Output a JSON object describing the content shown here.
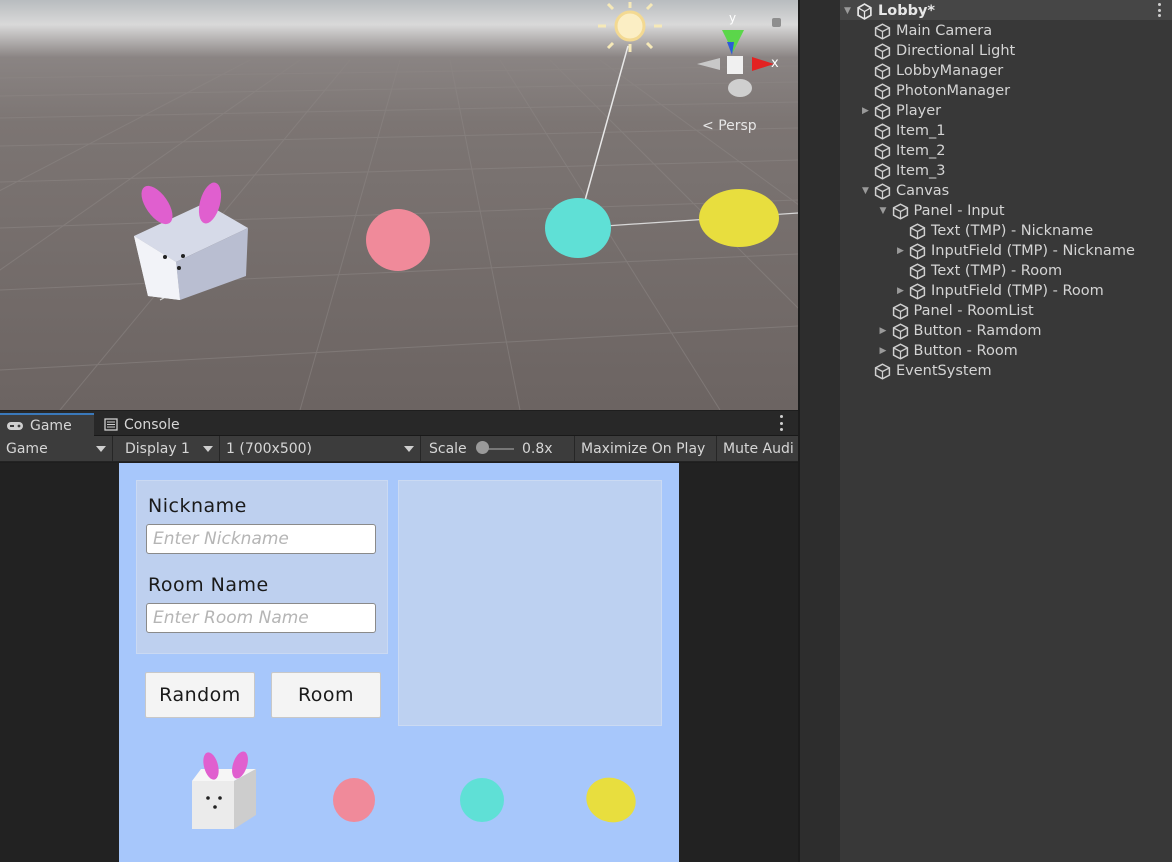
{
  "scene": {
    "persp_label": "Persp",
    "gizmo": {
      "x_label": "x",
      "y_label": "y"
    }
  },
  "tabs": [
    {
      "label": "Game",
      "icon": "gamepad-icon",
      "active": true
    },
    {
      "label": "Console",
      "icon": "console-icon",
      "active": false
    }
  ],
  "game_toolbar": {
    "mode": "Game",
    "display": "Display 1",
    "resolution": "1 (700x500)",
    "scale_label": "Scale",
    "scale_value": "0.8x",
    "maximize": "Maximize On Play",
    "mute": "Mute Audi"
  },
  "game_ui": {
    "nickname_label": "Nickname",
    "nickname_placeholder": "Enter Nickname",
    "room_label": "Room Name",
    "room_placeholder": "Enter Room Name",
    "random_button": "Random",
    "room_button": "Room"
  },
  "hierarchy": {
    "root": "Lobby*",
    "items": [
      {
        "label": "Main Camera",
        "depth": 0,
        "expand": "none"
      },
      {
        "label": "Directional Light",
        "depth": 0,
        "expand": "none"
      },
      {
        "label": "LobbyManager",
        "depth": 0,
        "expand": "none"
      },
      {
        "label": "PhotonManager",
        "depth": 0,
        "expand": "none"
      },
      {
        "label": "Player",
        "depth": 0,
        "expand": "collapsed"
      },
      {
        "label": "Item_1",
        "depth": 0,
        "expand": "none"
      },
      {
        "label": "Item_2",
        "depth": 0,
        "expand": "none"
      },
      {
        "label": "Item_3",
        "depth": 0,
        "expand": "none"
      },
      {
        "label": "Canvas",
        "depth": 0,
        "expand": "expanded"
      },
      {
        "label": "Panel - Input",
        "depth": 1,
        "expand": "expanded"
      },
      {
        "label": "Text (TMP) - Nickname",
        "depth": 2,
        "expand": "none"
      },
      {
        "label": "InputField (TMP) - Nickname",
        "depth": 2,
        "expand": "collapsed"
      },
      {
        "label": "Text (TMP) - Room",
        "depth": 2,
        "expand": "none"
      },
      {
        "label": "InputField (TMP) - Room",
        "depth": 2,
        "expand": "collapsed"
      },
      {
        "label": "Panel - RoomList",
        "depth": 1,
        "expand": "none"
      },
      {
        "label": "Button - Ramdom",
        "depth": 1,
        "expand": "collapsed"
      },
      {
        "label": "Button - Room",
        "depth": 1,
        "expand": "collapsed"
      },
      {
        "label": "EventSystem",
        "depth": 0,
        "expand": "none"
      }
    ]
  },
  "colors": {
    "accent": "#3a79bb",
    "game_background": "#a7c7fb",
    "bunny_ears": "#e05fcf",
    "ball_pink": "#f08a9a",
    "ball_cyan": "#5fe0d6",
    "ball_yellow": "#e8de3e"
  }
}
